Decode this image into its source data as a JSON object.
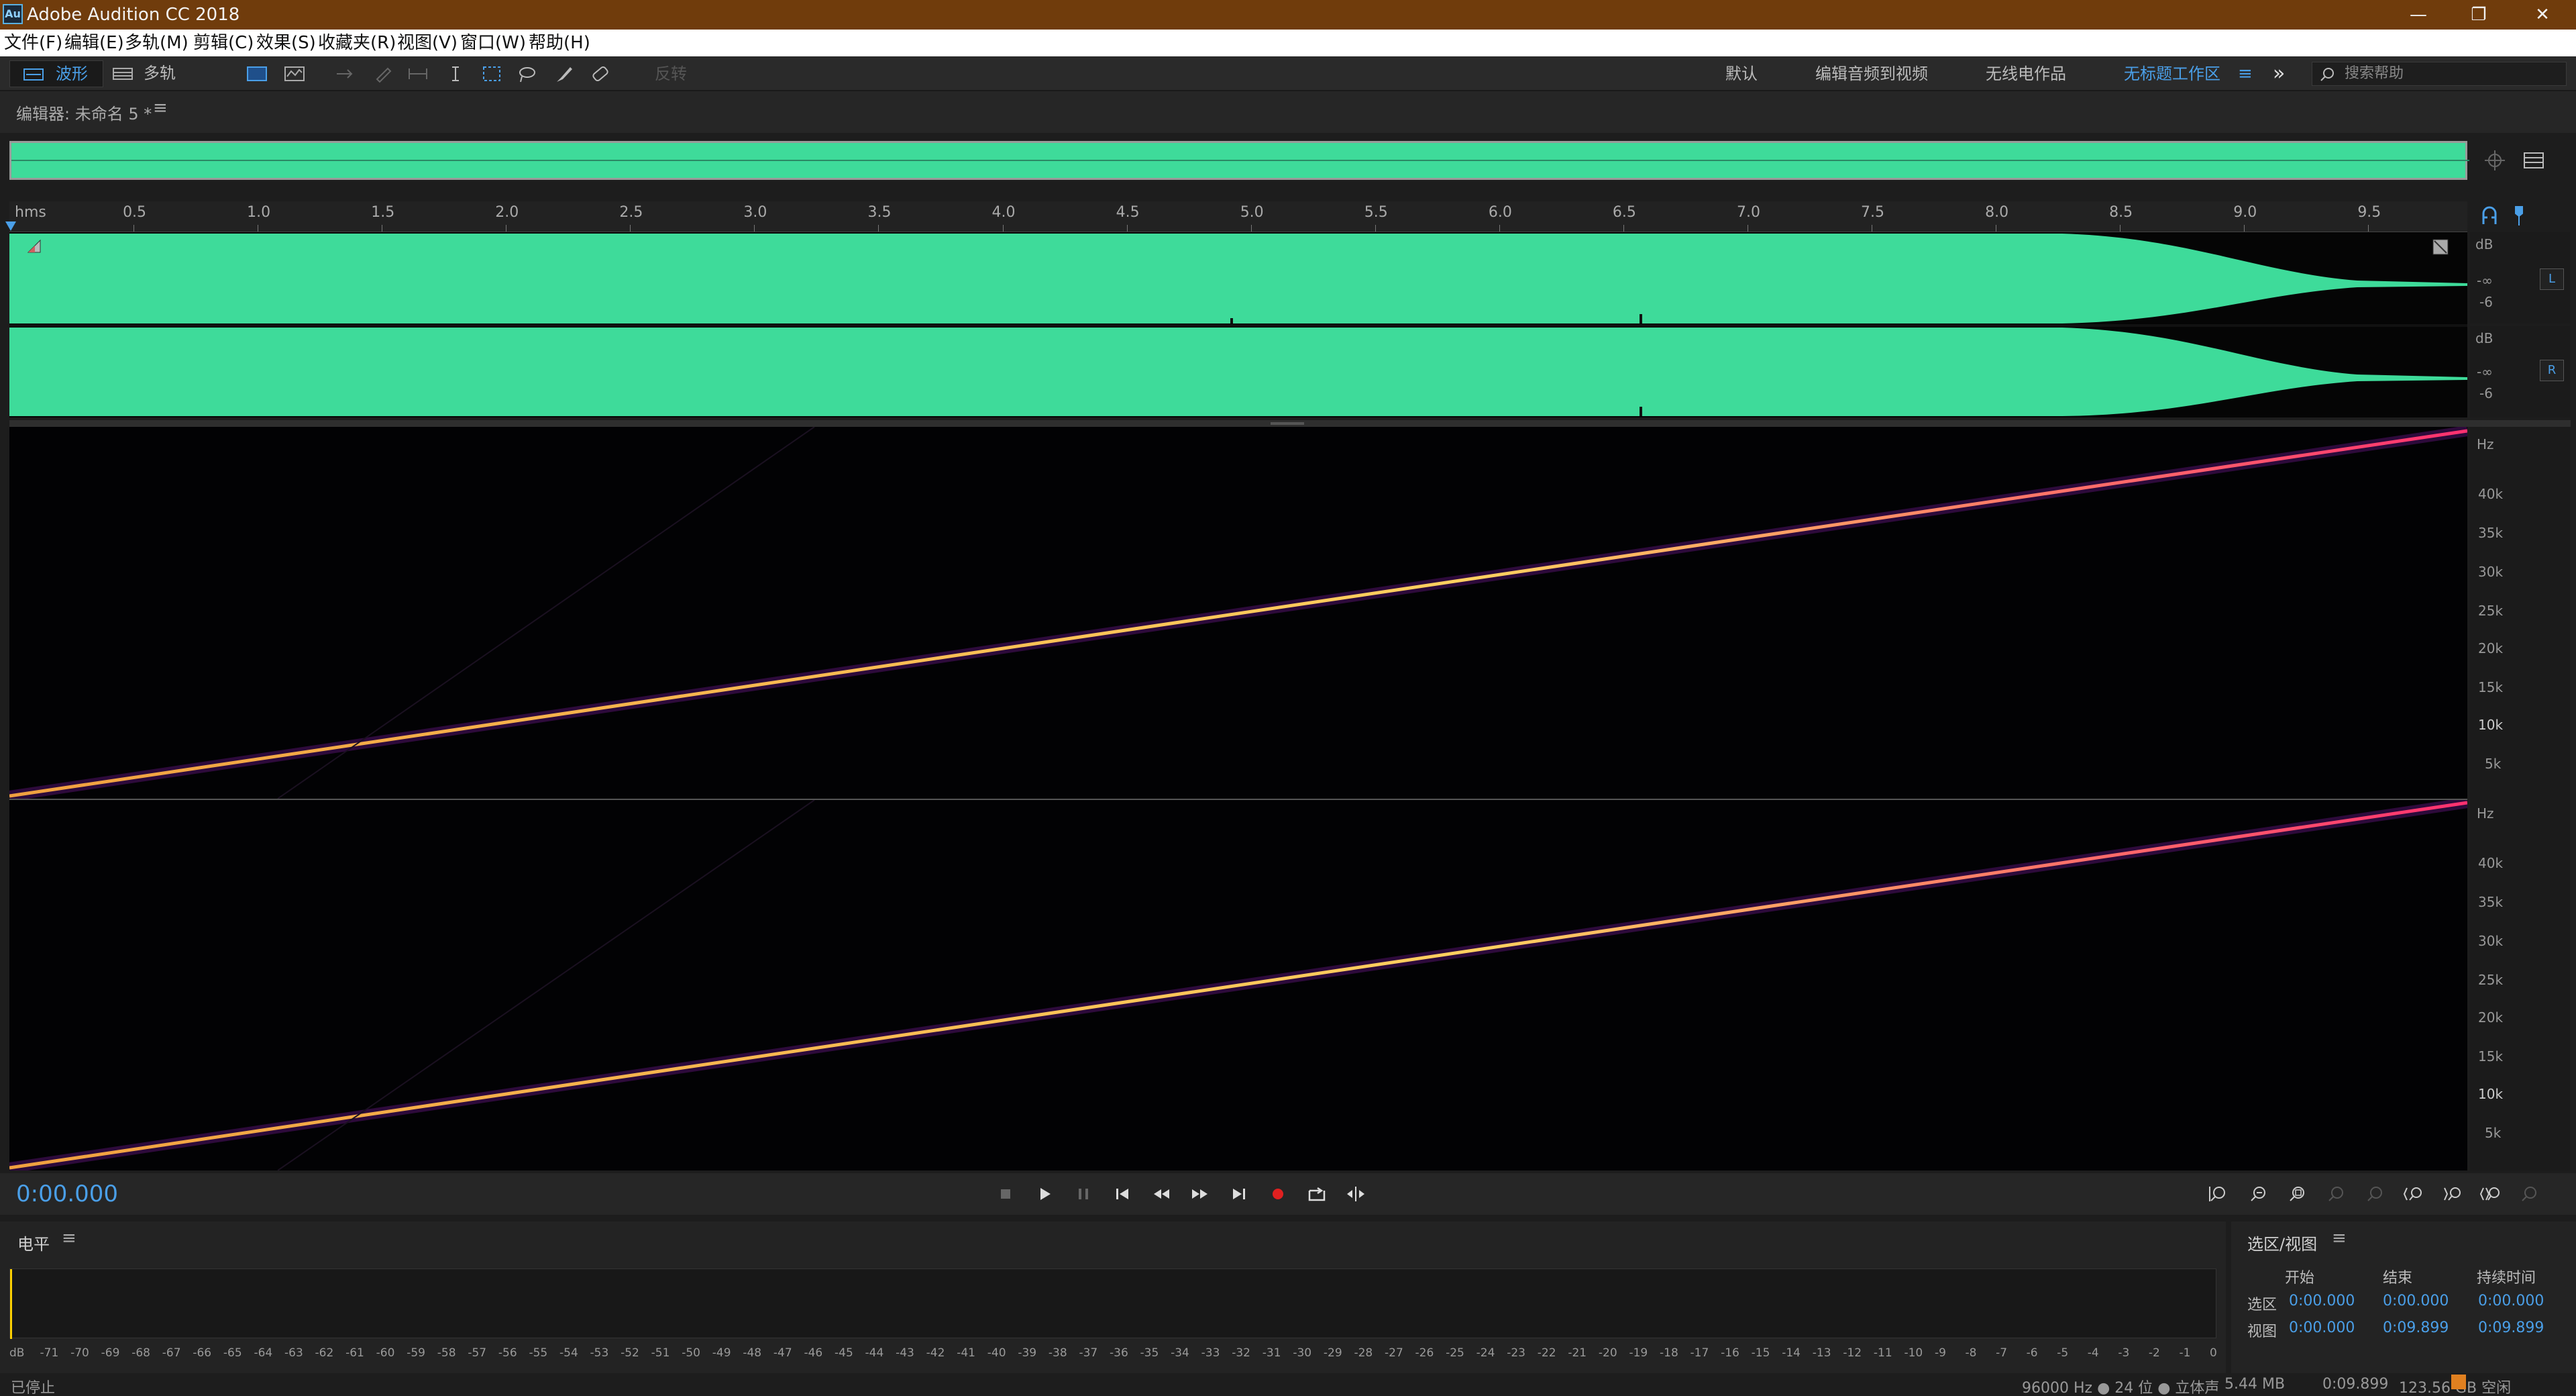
{
  "window": {
    "title": "Adobe Audition CC 2018",
    "icon_text": "Au",
    "buttons": [
      "minimize-icon",
      "restore-icon",
      "close-icon"
    ]
  },
  "menu": [
    "文件(F)",
    "编辑(E)",
    "多轨(M)",
    "剪辑(C)",
    "效果(S)",
    "收藏夹(R)",
    "视图(V)",
    "窗口(W)",
    "帮助(H)"
  ],
  "toolbar": {
    "waveform_label": "波形",
    "multitrack_label": "多轨",
    "reverse_label": "反转",
    "workspaces": [
      "默认",
      "编辑音频到视频",
      "无线电作品",
      "无标题工作区"
    ],
    "active_workspace_index": 3,
    "overflow_label": "»",
    "search_placeholder": "搜索帮助"
  },
  "editor": {
    "title": "编辑器: 未命名 5 *"
  },
  "ruler": {
    "unit": "hms",
    "ticks": [
      "0.5",
      "1.0",
      "1.5",
      "2.0",
      "2.5",
      "3.0",
      "3.5",
      "4.0",
      "4.5",
      "5.0",
      "5.5",
      "6.0",
      "6.5",
      "7.0",
      "7.5",
      "8.0",
      "8.5",
      "9.0",
      "9.5"
    ]
  },
  "db_scale": {
    "unit": "dB",
    "labels": [
      "-∞",
      "-6"
    ],
    "channels": [
      "L",
      "R"
    ]
  },
  "hz_scale": {
    "unit": "Hz",
    "labels": [
      "40k",
      "35k",
      "30k",
      "25k",
      "20k",
      "15k",
      "10k",
      "5k"
    ]
  },
  "transport": {
    "time": "0:00.000",
    "buttons": [
      "stop-icon",
      "play-icon",
      "pause-icon",
      "go-start-icon",
      "rewind-icon",
      "fast-forward-icon",
      "go-end-icon",
      "record-icon",
      "loop-icon",
      "skip-selection-icon"
    ],
    "record_color": "#e02020"
  },
  "level_panel": {
    "title": "电平",
    "scale": [
      "dB",
      "-71",
      "-70",
      "-69",
      "-68",
      "-67",
      "-66",
      "-65",
      "-64",
      "-63",
      "-62",
      "-61",
      "-60",
      "-59",
      "-58",
      "-57",
      "-56",
      "-55",
      "-54",
      "-53",
      "-52",
      "-51",
      "-50",
      "-49",
      "-48",
      "-47",
      "-46",
      "-45",
      "-44",
      "-43",
      "-42",
      "-41",
      "-40",
      "-39",
      "-38",
      "-37",
      "-36",
      "-35",
      "-34",
      "-33",
      "-32",
      "-31",
      "-30",
      "-29",
      "-28",
      "-27",
      "-26",
      "-25",
      "-24",
      "-23",
      "-22",
      "-21",
      "-20",
      "-19",
      "-18",
      "-17",
      "-16",
      "-15",
      "-14",
      "-13",
      "-12",
      "-11",
      "-10",
      "-9",
      "-8",
      "-7",
      "-6",
      "-5",
      "-4",
      "-3",
      "-2",
      "-1",
      "0"
    ]
  },
  "selection_panel": {
    "title": "选区/视图",
    "headers": [
      "开始",
      "结束",
      "持续时间"
    ],
    "rows": [
      {
        "label": "选区",
        "start": "0:00.000",
        "end": "0:00.000",
        "duration": "0:00.000"
      },
      {
        "label": "视图",
        "start": "0:00.000",
        "end": "0:09.899",
        "duration": "0:09.899"
      }
    ]
  },
  "status": {
    "state": "已停止",
    "sample_info": "96000 Hz ● 24 位 ● 立体声",
    "size": "5.44 MB",
    "duration": "0:09.899",
    "free_space": "123.56 GB 空闲"
  },
  "colors": {
    "waveform": "#3edb9a",
    "accent": "#4a9fe8",
    "titlebar": "#703c0c"
  }
}
